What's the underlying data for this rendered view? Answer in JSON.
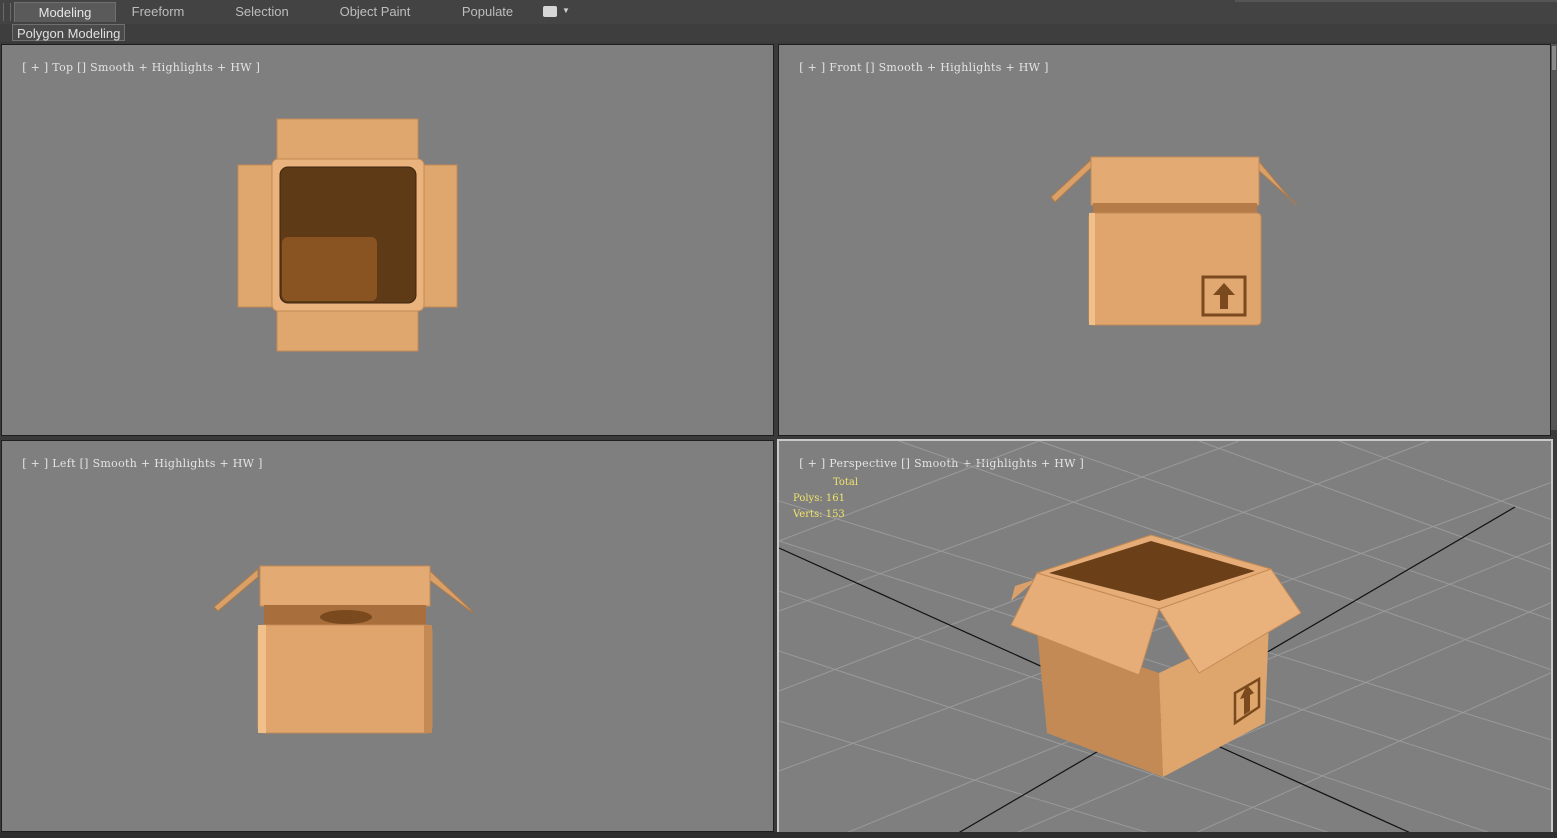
{
  "ribbon": {
    "tabs": [
      {
        "label": "Modeling",
        "active": true
      },
      {
        "label": "Freeform",
        "active": false
      },
      {
        "label": "Selection",
        "active": false
      },
      {
        "label": "Object Paint",
        "active": false
      },
      {
        "label": "Populate",
        "active": false
      }
    ],
    "more_icon": "dropdown-menu-icon"
  },
  "panel": {
    "label": "Polygon Modeling"
  },
  "viewports": {
    "top": {
      "plus": "[ + ]",
      "view": "Top",
      "shading": "Smooth + Highlights + HW ]"
    },
    "front": {
      "plus": "[ + ]",
      "view": "Front",
      "shading": "Smooth + Highlights + HW ]"
    },
    "left": {
      "plus": "[ + ]",
      "view": "Left",
      "shading": "Smooth + Highlights + HW ]"
    },
    "perspective": {
      "plus": "[ + ]",
      "view": "Perspective",
      "shading": "Smooth + Highlights + HW ]"
    }
  },
  "stats": {
    "total_label": "Total",
    "polys": "Polys: 161",
    "verts": "Verts: 153",
    "color": "#f1e36b"
  },
  "colors": {
    "viewport_bg": "#7f7f7f",
    "box_light": "#e2a872",
    "box_mid": "#c98a55",
    "box_dark": "#6b3f17"
  }
}
